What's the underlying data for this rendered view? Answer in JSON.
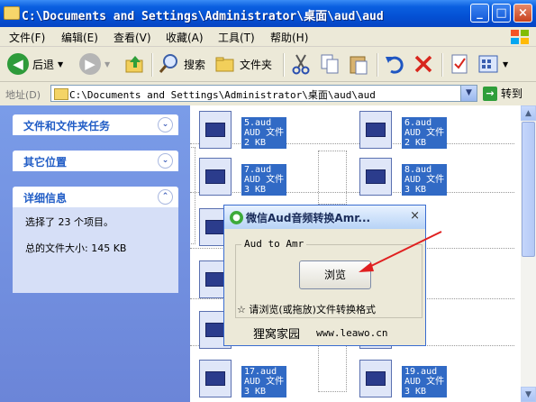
{
  "window": {
    "title": "C:\\Documents and Settings\\Administrator\\桌面\\aud\\aud",
    "min": "_",
    "max": "□",
    "close": "×"
  },
  "menu": [
    "文件(F)",
    "编辑(E)",
    "查看(V)",
    "收藏(A)",
    "工具(T)",
    "帮助(H)"
  ],
  "toolbar": {
    "back": "后退",
    "search": "搜索",
    "folders": "文件夹"
  },
  "address": {
    "label": "地址(D)",
    "value": "C:\\Documents and Settings\\Administrator\\桌面\\aud\\aud",
    "go": "转到"
  },
  "leftpane": {
    "panel1": "文件和文件夹任务",
    "panel2": "其它位置",
    "panel3": "详细信息",
    "detail_selected": "选择了 23 个项目。",
    "detail_size": "总的文件大小: 145 KB"
  },
  "files": [
    {
      "name": "5.aud",
      "type": "AUD 文件",
      "size": "2 KB"
    },
    {
      "name": "6.aud",
      "type": "AUD 文件",
      "size": "2 KB"
    },
    {
      "name": "7.aud",
      "type": "AUD 文件",
      "size": "3 KB"
    },
    {
      "name": "8.aud",
      "type": "AUD 文件",
      "size": "3 KB"
    },
    {
      "name": "17.aud",
      "type": "AUD 文件",
      "size": "3 KB"
    },
    {
      "name": "19.aud",
      "type": "AUD 文件",
      "size": "3 KB"
    }
  ],
  "dialog": {
    "title": "微信Aud音频转换Amr...",
    "close": "×",
    "group": "Aud to Amr",
    "browse": "浏览",
    "hint": "☆ 请浏览(或拖放)文件转换格式",
    "footer_left": "狸窝家园",
    "footer_right": "www.leawo.cn"
  },
  "colors": {
    "title_blue": "#0451d4",
    "selection": "#316ac5",
    "task_pane": "#7a9ce8",
    "arrow": "#e02020"
  }
}
